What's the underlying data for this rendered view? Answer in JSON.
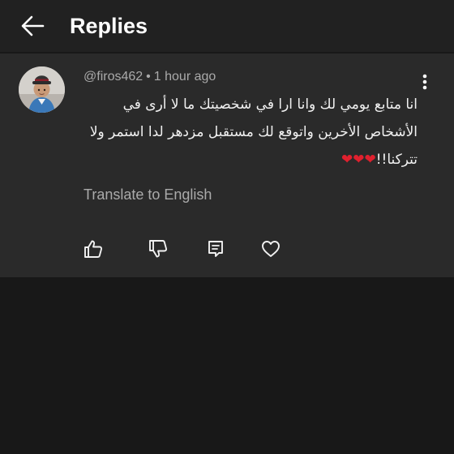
{
  "header": {
    "title": "Replies",
    "back_icon": "arrow-left-icon"
  },
  "comment": {
    "avatar_icon": "user-avatar",
    "author": "@firos462",
    "separator": "•",
    "time": "1 hour ago",
    "text_lines": [
      "انا متابع يومي لك وانا ارا في شخصيتك ما لا أرى في",
      "الأشخاص الأخرين واتوقع لك مستقبل مزدهر لدا استمر ولا",
      "تتركنا!!"
    ],
    "emoji": "❤❤❤",
    "translate_label": "Translate to English",
    "menu_icon": "more-vertical-icon",
    "actions": {
      "like_icon": "thumbs-up-icon",
      "dislike_icon": "thumbs-down-icon",
      "reply_icon": "reply-icon",
      "heart_icon": "heart-icon"
    }
  },
  "colors": {
    "background": "#181818",
    "header": "#212121",
    "card": "#2a2a2a",
    "text_primary": "#f1f1f1",
    "text_secondary": "#aaaaaa",
    "heart": "#e0202e"
  }
}
